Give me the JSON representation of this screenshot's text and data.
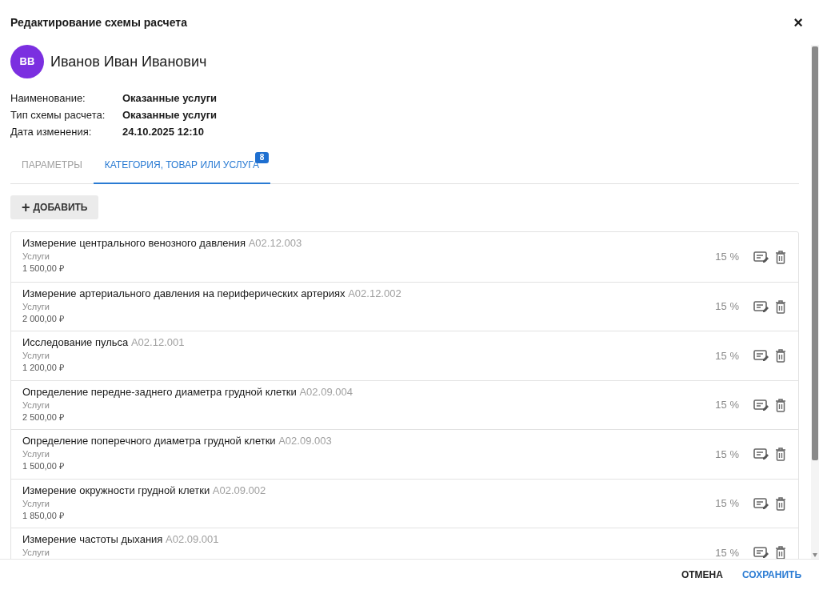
{
  "dialog": {
    "title": "Редактирование схемы расчета",
    "close": "×"
  },
  "person": {
    "initials": "ВВ",
    "name": "Иванов Иван Иванович"
  },
  "details": [
    {
      "label": "Наименование:",
      "value": "Оказанные услуги"
    },
    {
      "label": "Тип схемы расчета:",
      "value": "Оказанные услуги"
    },
    {
      "label": "Дата изменения:",
      "value": "24.10.2025 12:10"
    }
  ],
  "tabs": [
    {
      "label": "ПАРАМЕТРЫ",
      "selected": false
    },
    {
      "label": "КАТЕГОРИЯ, ТОВАР ИЛИ УСЛУГА",
      "selected": true,
      "badge": "8"
    }
  ],
  "add_button": {
    "icon": "+",
    "label": "ДОБАВИТЬ"
  },
  "items": [
    {
      "name": "Измерение центрального венозного давления",
      "code": "A02.12.003",
      "category": "Услуги",
      "price": "1 500,00 ₽",
      "percent": "15 %"
    },
    {
      "name": "Измерение артериального давления на периферических артериях",
      "code": "A02.12.002",
      "category": "Услуги",
      "price": "2 000,00 ₽",
      "percent": "15 %"
    },
    {
      "name": "Исследование пульса",
      "code": "A02.12.001",
      "category": "Услуги",
      "price": "1 200,00 ₽",
      "percent": "15 %"
    },
    {
      "name": "Определение передне-заднего диаметра грудной клетки",
      "code": "A02.09.004",
      "category": "Услуги",
      "price": "2 500,00 ₽",
      "percent": "15 %"
    },
    {
      "name": "Определение поперечного диаметра грудной клетки",
      "code": "A02.09.003",
      "category": "Услуги",
      "price": "1 500,00 ₽",
      "percent": "15 %"
    },
    {
      "name": "Измерение окружности грудной клетки",
      "code": "A02.09.002",
      "category": "Услуги",
      "price": "1 850,00 ₽",
      "percent": "15 %"
    },
    {
      "name": "Измерение частоты дыхания",
      "code": "A02.09.001",
      "category": "Услуги",
      "percent": "15 %"
    }
  ],
  "footer_buttons": [
    {
      "label": "ОТМЕНА",
      "kind": "secondary"
    },
    {
      "label": "СОХРАНИТЬ",
      "kind": "primary"
    }
  ]
}
